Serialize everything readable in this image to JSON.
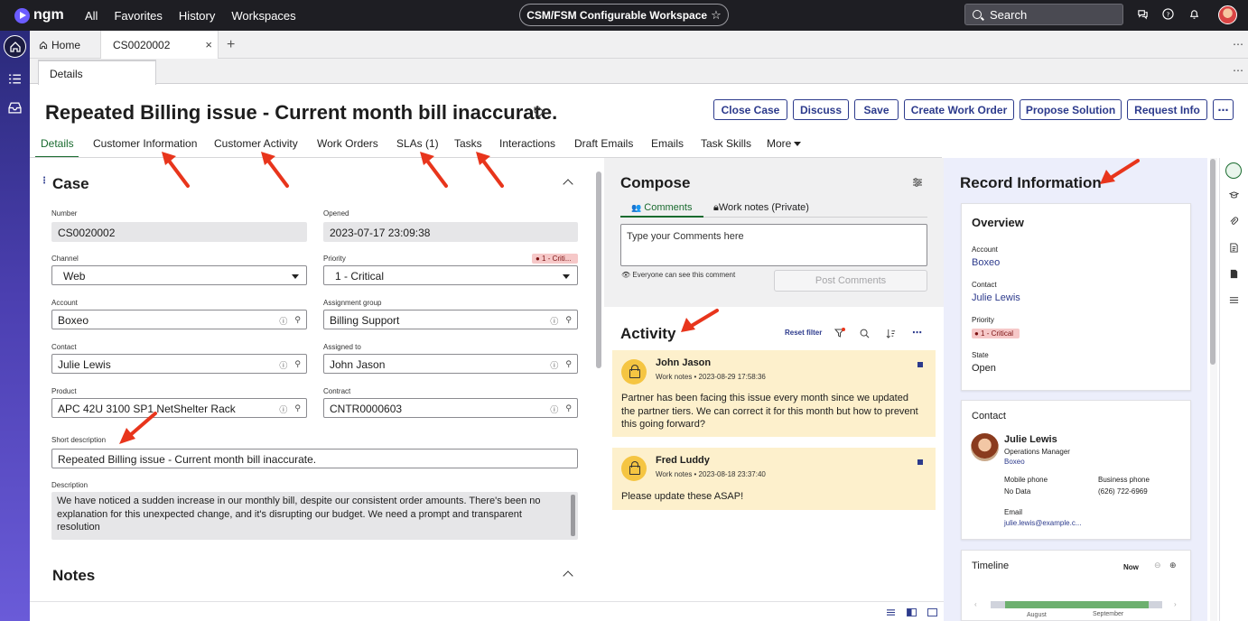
{
  "topbar": {
    "logo": "ngm",
    "nav": [
      "All",
      "Favorites",
      "History",
      "Workspaces"
    ],
    "workspace": "CSM/FSM Configurable Workspace",
    "search_placeholder": "Search"
  },
  "tabs": {
    "home": "Home",
    "record": "CS0020002",
    "close": "×",
    "add": "+"
  },
  "subtab": "Details",
  "header": {
    "title": "Repeated Billing issue - Current month bill inaccurate.",
    "buttons": [
      "Close Case",
      "Discuss",
      "Save",
      "Create Work Order",
      "Propose Solution",
      "Request Info"
    ],
    "more": "⋯"
  },
  "formtabs": [
    "Details",
    "Customer Information",
    "Customer Activity",
    "Work Orders",
    "SLAs (1)",
    "Tasks",
    "Interactions",
    "Draft Emails",
    "Emails",
    "Task Skills",
    "More"
  ],
  "case": {
    "title": "Case",
    "number_label": "Number",
    "number": "CS0020002",
    "opened_label": "Opened",
    "opened": "2023-07-17 23:09:38",
    "channel_label": "Channel",
    "channel": "Web",
    "priority_label": "Priority",
    "priority": "1 - Critical",
    "priority_badge": "● 1 - Criti...",
    "account_label": "Account",
    "account": "Boxeo",
    "assignment_group_label": "Assignment group",
    "assignment_group": "Billing Support",
    "contact_label": "Contact",
    "contact": "Julie Lewis",
    "assigned_to_label": "Assigned to",
    "assigned_to": "John Jason",
    "product_label": "Product",
    "product": "APC 42U 3100 SP1 NetShelter Rack",
    "contract_label": "Contract",
    "contract": "CNTR0000603",
    "short_desc_label": "Short description",
    "short_desc": "Repeated Billing issue - Current month bill inaccurate.",
    "desc_label": "Description",
    "desc": "We have noticed a sudden increase in our monthly bill, despite our consistent order amounts. There's been no explanation for this unexpected change, and it's disrupting our budget.  We need a prompt and transparent resolution"
  },
  "notes": {
    "title": "Notes"
  },
  "compose": {
    "title": "Compose",
    "tab_comments": "Comments",
    "tab_worknotes": "Work notes (Private)",
    "placeholder": "Type your Comments here",
    "visibility": "Everyone can see this comment",
    "post": "Post Comments"
  },
  "activity": {
    "title": "Activity",
    "reset": "Reset filter",
    "items": [
      {
        "name": "John Jason",
        "meta": "Work notes • 2023-08-29 17:58:36",
        "text": "Partner has been facing this issue every month since we updated the partner tiers. We can correct it for this month but how to prevent this going forward?"
      },
      {
        "name": "Fred Luddy",
        "meta": "Work notes • 2023-08-18 23:37:40",
        "text": "Please update these ASAP!"
      }
    ]
  },
  "record_info": {
    "title": "Record Information",
    "overview": {
      "title": "Overview",
      "account_label": "Account",
      "account": "Boxeo",
      "contact_label": "Contact",
      "contact": "Julie Lewis",
      "priority_label": "Priority",
      "priority": "● 1 - Critical",
      "state_label": "State",
      "state": "Open"
    },
    "contact": {
      "title": "Contact",
      "name": "Julie Lewis",
      "role": "Operations Manager",
      "company": "Boxeo",
      "mobile_label": "Mobile phone",
      "mobile": "No Data",
      "business_label": "Business phone",
      "business": "(626) 722-6969",
      "email_label": "Email",
      "email": "julie.lewis@example.c..."
    },
    "timeline": {
      "title": "Timeline",
      "now": "Now",
      "months": [
        "August",
        "September"
      ]
    }
  },
  "colors": {
    "topbar": "#1e1e23",
    "accent": "#2c3a8c",
    "active_tab": "#1a6b2f",
    "critical_bg": "#f6c8c8",
    "activity_card": "#fdf0cc",
    "arrow": "#e8351c"
  }
}
